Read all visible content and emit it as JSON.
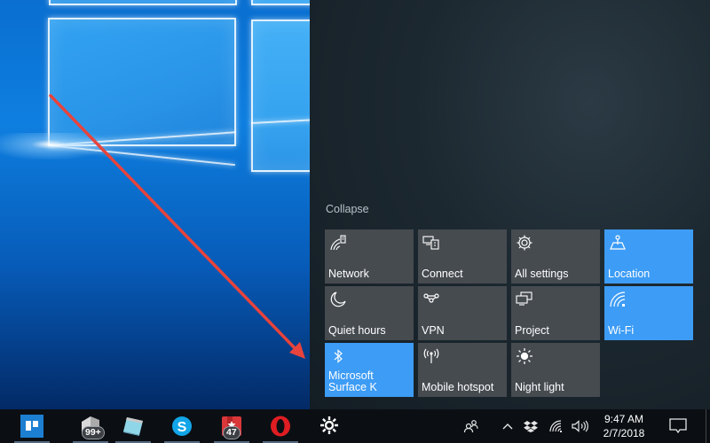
{
  "action_center": {
    "collapse_label": "Collapse",
    "accent_color": "#3d9cf5",
    "tile_off_color": "#464b50",
    "tiles": [
      {
        "label": "Network",
        "icon": "network-icon",
        "active": false
      },
      {
        "label": "Connect",
        "icon": "connect-icon",
        "active": false
      },
      {
        "label": "All settings",
        "icon": "gear-icon",
        "active": false
      },
      {
        "label": "Location",
        "icon": "location-icon",
        "active": true
      },
      {
        "label": "Quiet hours",
        "icon": "moon-icon",
        "active": false
      },
      {
        "label": "VPN",
        "icon": "vpn-icon",
        "active": false
      },
      {
        "label": "Project",
        "icon": "project-icon",
        "active": false
      },
      {
        "label": "Wi-Fi",
        "icon": "wifi-icon",
        "active": true
      },
      {
        "label": "Microsoft Surface K",
        "icon": "bluetooth-icon",
        "active": true
      },
      {
        "label": "Mobile hotspot",
        "icon": "hotspot-icon",
        "active": false
      },
      {
        "label": "Night light",
        "icon": "brightness-icon",
        "active": false
      }
    ]
  },
  "taskbar": {
    "apps": [
      {
        "name": "trello",
        "icon": "trello-icon",
        "badge": null
      },
      {
        "name": "mail",
        "icon": "mail-icon",
        "badge": "99+"
      },
      {
        "name": "notepad",
        "icon": "notepad-icon",
        "badge": null
      },
      {
        "name": "skype",
        "icon": "skype-icon",
        "badge": null
      },
      {
        "name": "wunderlist",
        "icon": "wunderlist-icon",
        "badge": "47"
      },
      {
        "name": "opera",
        "icon": "opera-icon",
        "badge": null
      },
      {
        "name": "settings",
        "icon": "gear-icon",
        "badge": null
      }
    ],
    "tray": {
      "people": "people-icon",
      "show_hidden": "chevron-up-icon",
      "dropbox": "dropbox-icon",
      "network": "wifi-icon",
      "volume": "volume-icon"
    },
    "time": "9:47 AM",
    "date": "2/7/2018",
    "notifications": "action-center-icon"
  },
  "annotation": {
    "arrow_color": "#e8433c"
  }
}
